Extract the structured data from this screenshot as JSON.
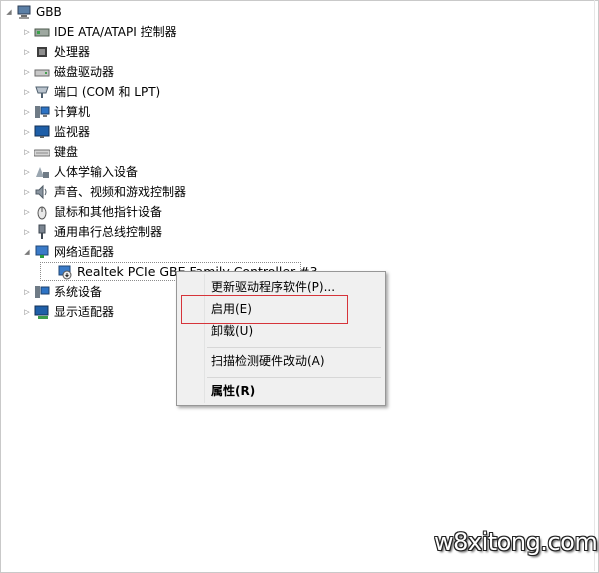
{
  "tree": {
    "root": {
      "label": "GBB",
      "icon": "computer-icon"
    },
    "items": [
      {
        "label": "IDE ATA/ATAPI 控制器",
        "icon": "ide-controller-icon",
        "expanded": false
      },
      {
        "label": "处理器",
        "icon": "processor-icon",
        "expanded": false
      },
      {
        "label": "磁盘驱动器",
        "icon": "disk-drive-icon",
        "expanded": false
      },
      {
        "label": "端口 (COM 和 LPT)",
        "icon": "port-icon",
        "expanded": false
      },
      {
        "label": "计算机",
        "icon": "computer-icon",
        "expanded": false
      },
      {
        "label": "监视器",
        "icon": "monitor-icon",
        "expanded": false
      },
      {
        "label": "键盘",
        "icon": "keyboard-icon",
        "expanded": false
      },
      {
        "label": "人体学输入设备",
        "icon": "hid-icon",
        "expanded": false
      },
      {
        "label": "声音、视频和游戏控制器",
        "icon": "sound-icon",
        "expanded": false
      },
      {
        "label": "鼠标和其他指针设备",
        "icon": "mouse-icon",
        "expanded": false
      },
      {
        "label": "通用串行总线控制器",
        "icon": "usb-icon",
        "expanded": false
      },
      {
        "label": "网络适配器",
        "icon": "network-adapter-icon",
        "expanded": true
      },
      {
        "label": "系统设备",
        "icon": "system-device-icon",
        "expanded": false
      },
      {
        "label": "显示适配器",
        "icon": "display-adapter-icon",
        "expanded": false
      }
    ],
    "child": {
      "label": "Realtek PCIe GBE Family Controller #3",
      "icon": "disabled-network-device-icon"
    }
  },
  "context_menu": {
    "items": [
      {
        "label": "更新驱动程序软件(P)...",
        "bold": false
      },
      {
        "label": "启用(E)",
        "bold": false
      },
      {
        "label": "卸载(U)",
        "bold": false
      },
      {
        "label": "扫描检测硬件改动(A)",
        "bold": false
      },
      {
        "label": "属性(R)",
        "bold": true
      }
    ]
  },
  "highlight_color": "#d6343a",
  "watermark": "w8xitong.com"
}
